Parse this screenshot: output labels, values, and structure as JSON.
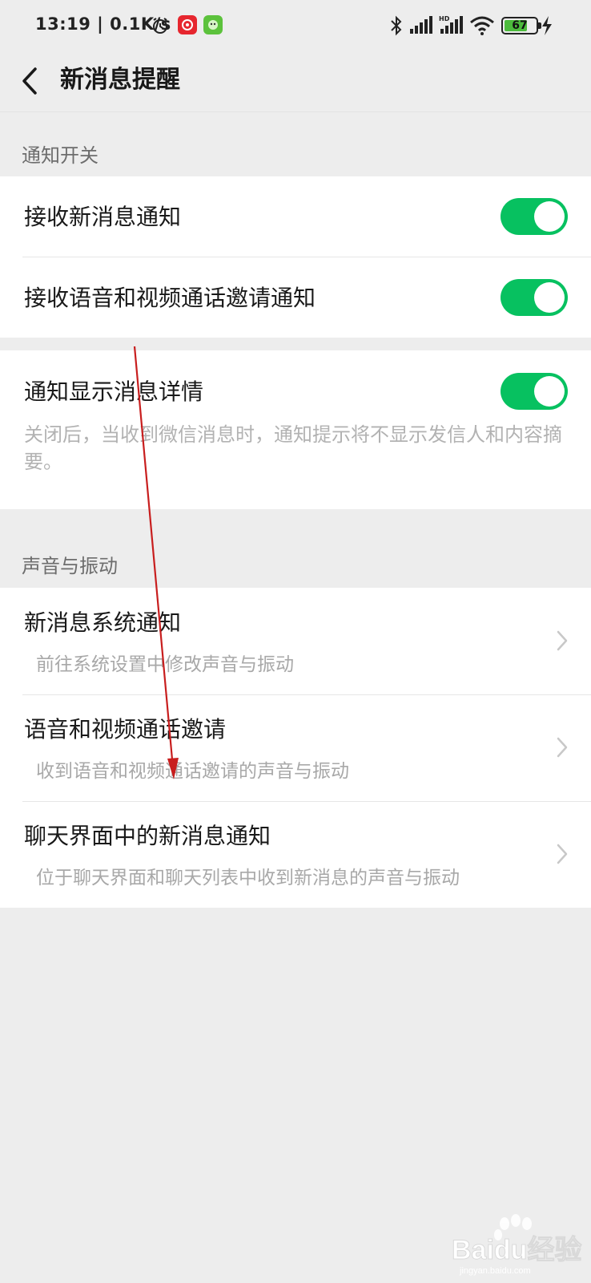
{
  "status_bar": {
    "time": "13:19 | 0.1K/s",
    "battery": "67"
  },
  "header": {
    "title": "新消息提醒"
  },
  "sections": {
    "notify_switch": {
      "label": "通知开关",
      "receive_new": "接收新消息通知",
      "receive_call": "接收语音和视频通话邀请通知",
      "show_detail": "通知显示消息详情",
      "show_detail_desc": "关闭后，当收到微信消息时，通知提示将不显示发信人和内容摘要。"
    },
    "sound_vibration": {
      "label": "声音与振动",
      "items": [
        {
          "title": "新消息系统通知",
          "subtitle": "前往系统设置中修改声音与振动"
        },
        {
          "title": "语音和视频通话邀请",
          "subtitle": "收到语音和视频通话邀请的声音与振动"
        },
        {
          "title": "聊天界面中的新消息通知",
          "subtitle": "位于聊天界面和聊天列表中收到新消息的声音与振动"
        }
      ]
    }
  },
  "toggles": {
    "receive_new": true,
    "receive_call": true,
    "show_detail": true
  },
  "colors": {
    "toggle_on": "#07c160",
    "background": "#ededed",
    "annotation_arrow": "#c81e1e"
  },
  "watermark": {
    "brand": "Baidu经验",
    "url": "jingyan.baidu.com"
  }
}
